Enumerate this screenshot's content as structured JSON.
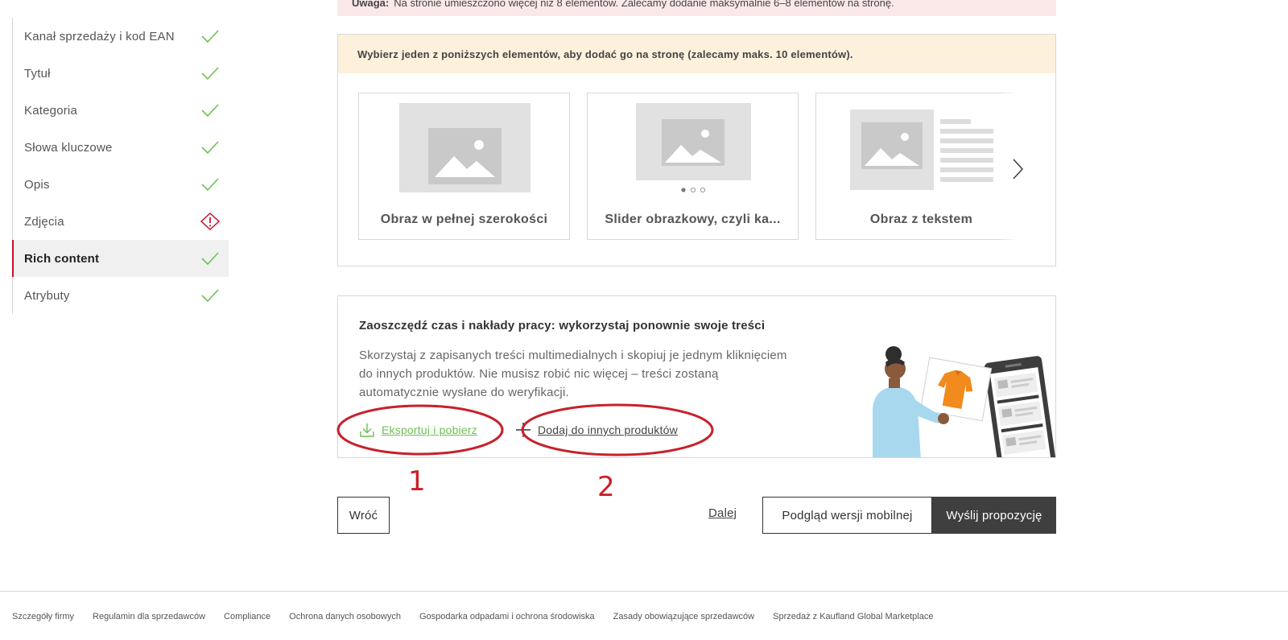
{
  "sidebar": {
    "items": [
      {
        "label": "Kanał sprzedaży i kod EAN",
        "status": "done"
      },
      {
        "label": "Tytuł",
        "status": "done"
      },
      {
        "label": "Kategoria",
        "status": "done"
      },
      {
        "label": "Słowa kluczowe",
        "status": "done"
      },
      {
        "label": "Opis",
        "status": "done"
      },
      {
        "label": "Zdjęcia",
        "status": "warning"
      },
      {
        "label": "Rich content",
        "status": "done",
        "active": true
      },
      {
        "label": "Atrybuty",
        "status": "done"
      }
    ]
  },
  "alert": {
    "prefix": "Uwaga:",
    "text": "Na stronie umieszczono więcej niż 8 elementów. Zalecamy dodanie maksymalnie 6–8 elementów na stronę."
  },
  "chooser": {
    "heading": "Wybierz jeden z poniższych elementów, aby dodać go na stronę (zalecamy maks. 10 elementów).",
    "tiles": [
      {
        "label": "Obraz w pełnej szerokości",
        "icon": "image-full-width-icon"
      },
      {
        "label": "Slider obrazkowy, czyli ka...",
        "icon": "image-slider-icon"
      },
      {
        "label": "Obraz z tekstem",
        "icon": "image-with-text-icon"
      }
    ]
  },
  "reuse": {
    "title": "Zaoszczędź czas i nakłady pracy: wykorzystaj ponownie swoje treści",
    "desc_lines": [
      "Skorzystaj z zapisanych treści multimedialnych i skopiuj je jednym kliknięciem",
      "do innych produktów. Nie musisz robić nic więcej – treści zostaną",
      "automatycznie wysłane do weryfikacji."
    ],
    "export_label": "Eksportuj i pobierz",
    "add_label": "Dodaj do innych produktów"
  },
  "annotations": {
    "one": "1",
    "two": "2"
  },
  "actions": {
    "back": "Wróć",
    "next": "Dalej",
    "preview": "Podgląd wersji mobilnej",
    "send": "Wyślij propozycję"
  },
  "footer": {
    "links": [
      "Szczegóły firmy",
      "Regulamin dla sprzedawców",
      "Compliance",
      "Ochrona danych osobowych",
      "Gospodarka odpadami i ochrona środowiska",
      "Zasady obowiązujące sprzedawców",
      "Sprzedaż z Kaufland Global Marketplace"
    ]
  },
  "colors": {
    "success": "#6dbf55",
    "warning": "#c8102e",
    "annotation": "#c8202a",
    "primary_button": "#3f3f3f"
  }
}
